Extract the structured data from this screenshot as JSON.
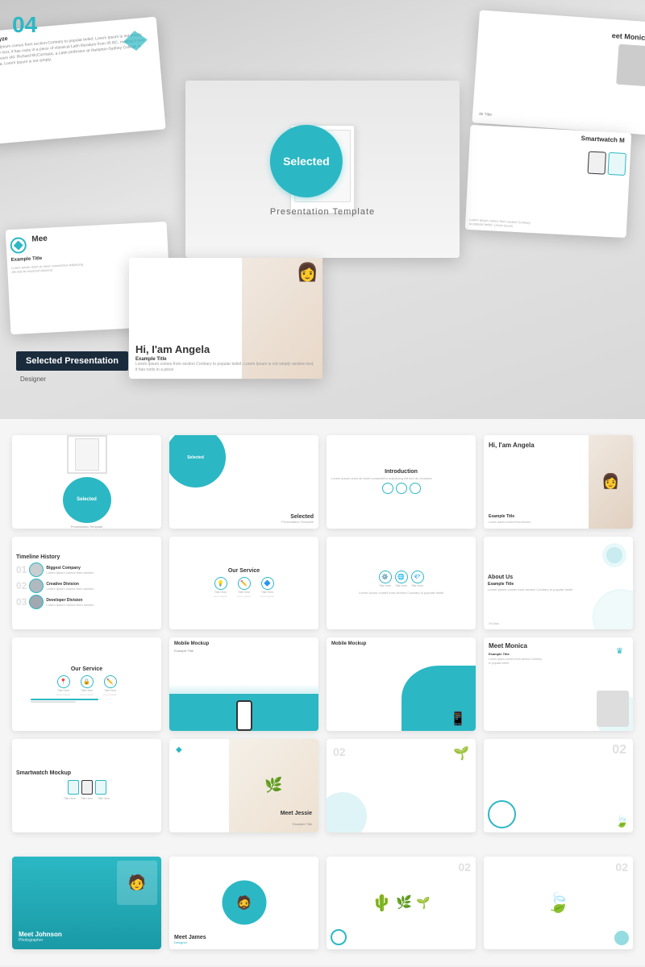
{
  "hero": {
    "badge_number": "04",
    "center_slide": {
      "badge_label": "Selected",
      "subtitle": "Presentation Template"
    },
    "selected_label": "Selected Presentation",
    "designer_label": "Designer",
    "angela_slide": {
      "title": "Hi, I'am Angela",
      "example_title": "Example Title",
      "body_text": "Lorem Ipsum comes from section Contrary to popular belief, Lorem Ipsum is not simply random text, it has roots in a piece"
    },
    "analyze_title": "Analyze",
    "analyze_text": "Lorem Ipsum comes from section-Contrary to popular belief, Lorem Ipsum is not simply random text, it has roots in a piece of classical Latin literature from 45 BC, making it over 2000 years old. Richard McCormack, a Latin professor at Hampton-Sydney College in Virginia, Lorem Ipsum is not simply.",
    "smartwatch_title": "Smartwatch M"
  },
  "grid_row1": {
    "slides": [
      {
        "id": "cover1",
        "title": "Selected",
        "subtitle": "Presentation Template"
      },
      {
        "id": "cover2",
        "title": "Selected",
        "subtitle": "Presentation Template"
      },
      {
        "id": "intro",
        "title": "Introduction",
        "body": "Lorem ipsum dolor sit amet consectetur adipiscing elit sed do eiusmod"
      },
      {
        "id": "angela",
        "title": "Hi, I'am Angela",
        "subtitle": "Example Title"
      }
    ]
  },
  "grid_row2": {
    "slides": [
      {
        "id": "timeline",
        "title": "Timeline History",
        "items": [
          {
            "num": "01",
            "name": "Biggest Company",
            "desc": "Lorem Ipsum comes from section"
          },
          {
            "num": "02",
            "name": "Creative Division",
            "desc": "Lorem Ipsum comes from section"
          },
          {
            "num": "03",
            "name": "Developer Division",
            "desc": "Lorem Ipsum comes from section"
          }
        ]
      },
      {
        "id": "service1",
        "title": "Our Service",
        "icons": [
          "💡",
          "✏️",
          "🔷"
        ]
      },
      {
        "id": "service2_icons",
        "title": "",
        "icons": [
          "⚙️",
          "🌐",
          "💎"
        ]
      },
      {
        "id": "about",
        "title": "About Us",
        "subtitle": "Example Title",
        "body": "Lorem Ipsum comes from section Contrary to popular belief"
      }
    ]
  },
  "grid_row3": {
    "slides": [
      {
        "id": "service3",
        "title": "Our Service",
        "icons": [
          "📍",
          "🔒",
          "✏️"
        ]
      },
      {
        "id": "mobile1",
        "title": "Mobile Mockup",
        "subtitle": "Example Title"
      },
      {
        "id": "mobile2",
        "title": "Mobile Mockup"
      },
      {
        "id": "monica",
        "title": "Meet Monica",
        "subtitle": "Example Title"
      }
    ]
  },
  "grid_row4": {
    "slides": [
      {
        "id": "smartwatch_title",
        "title": "Smartwatch Mockup"
      },
      {
        "id": "jessie",
        "title": "Meet Jessie",
        "subtitle": "Example Title"
      },
      {
        "id": "placeholder1",
        "title": ""
      },
      {
        "id": "placeholder2",
        "title": "02"
      }
    ]
  },
  "bottom_row": {
    "slides": [
      {
        "id": "johnson",
        "title": "Meet Johnson",
        "role": "Photographer"
      },
      {
        "id": "james",
        "title": "Meet James",
        "role": "Designer"
      },
      {
        "id": "plants",
        "title": "02"
      },
      {
        "id": "leaf",
        "title": "02"
      }
    ]
  }
}
